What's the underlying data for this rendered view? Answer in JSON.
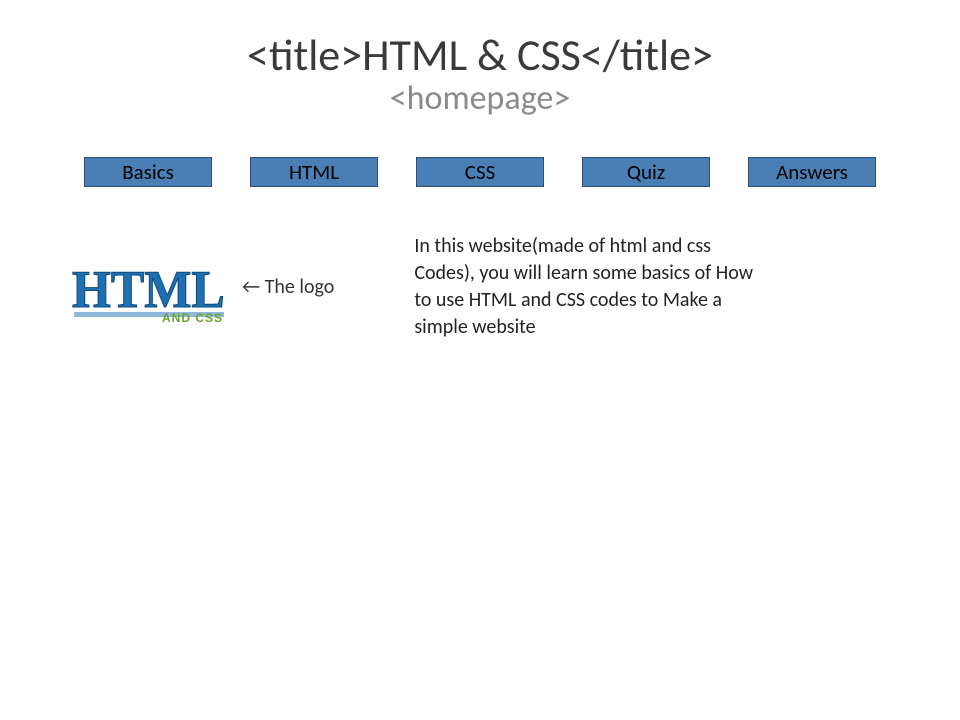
{
  "header": {
    "title": "<title>HTML & CSS</title>",
    "subtitle": "<homepage>"
  },
  "nav": {
    "items": [
      "Basics",
      "HTML",
      "CSS",
      "Quiz",
      "Answers"
    ]
  },
  "logo": {
    "main_text": "HTML",
    "sub_text": "AND CSS",
    "caption": "← The logo"
  },
  "body": {
    "paragraph": "In this website(made of html and css Codes), you will learn some basics of How to use HTML and CSS codes to Make a simple website"
  },
  "colors": {
    "button_bg": "#4a7fb5",
    "button_border": "#2c4f78",
    "logo_blue": "#1f6fb3",
    "logo_green": "#6aa32b"
  }
}
